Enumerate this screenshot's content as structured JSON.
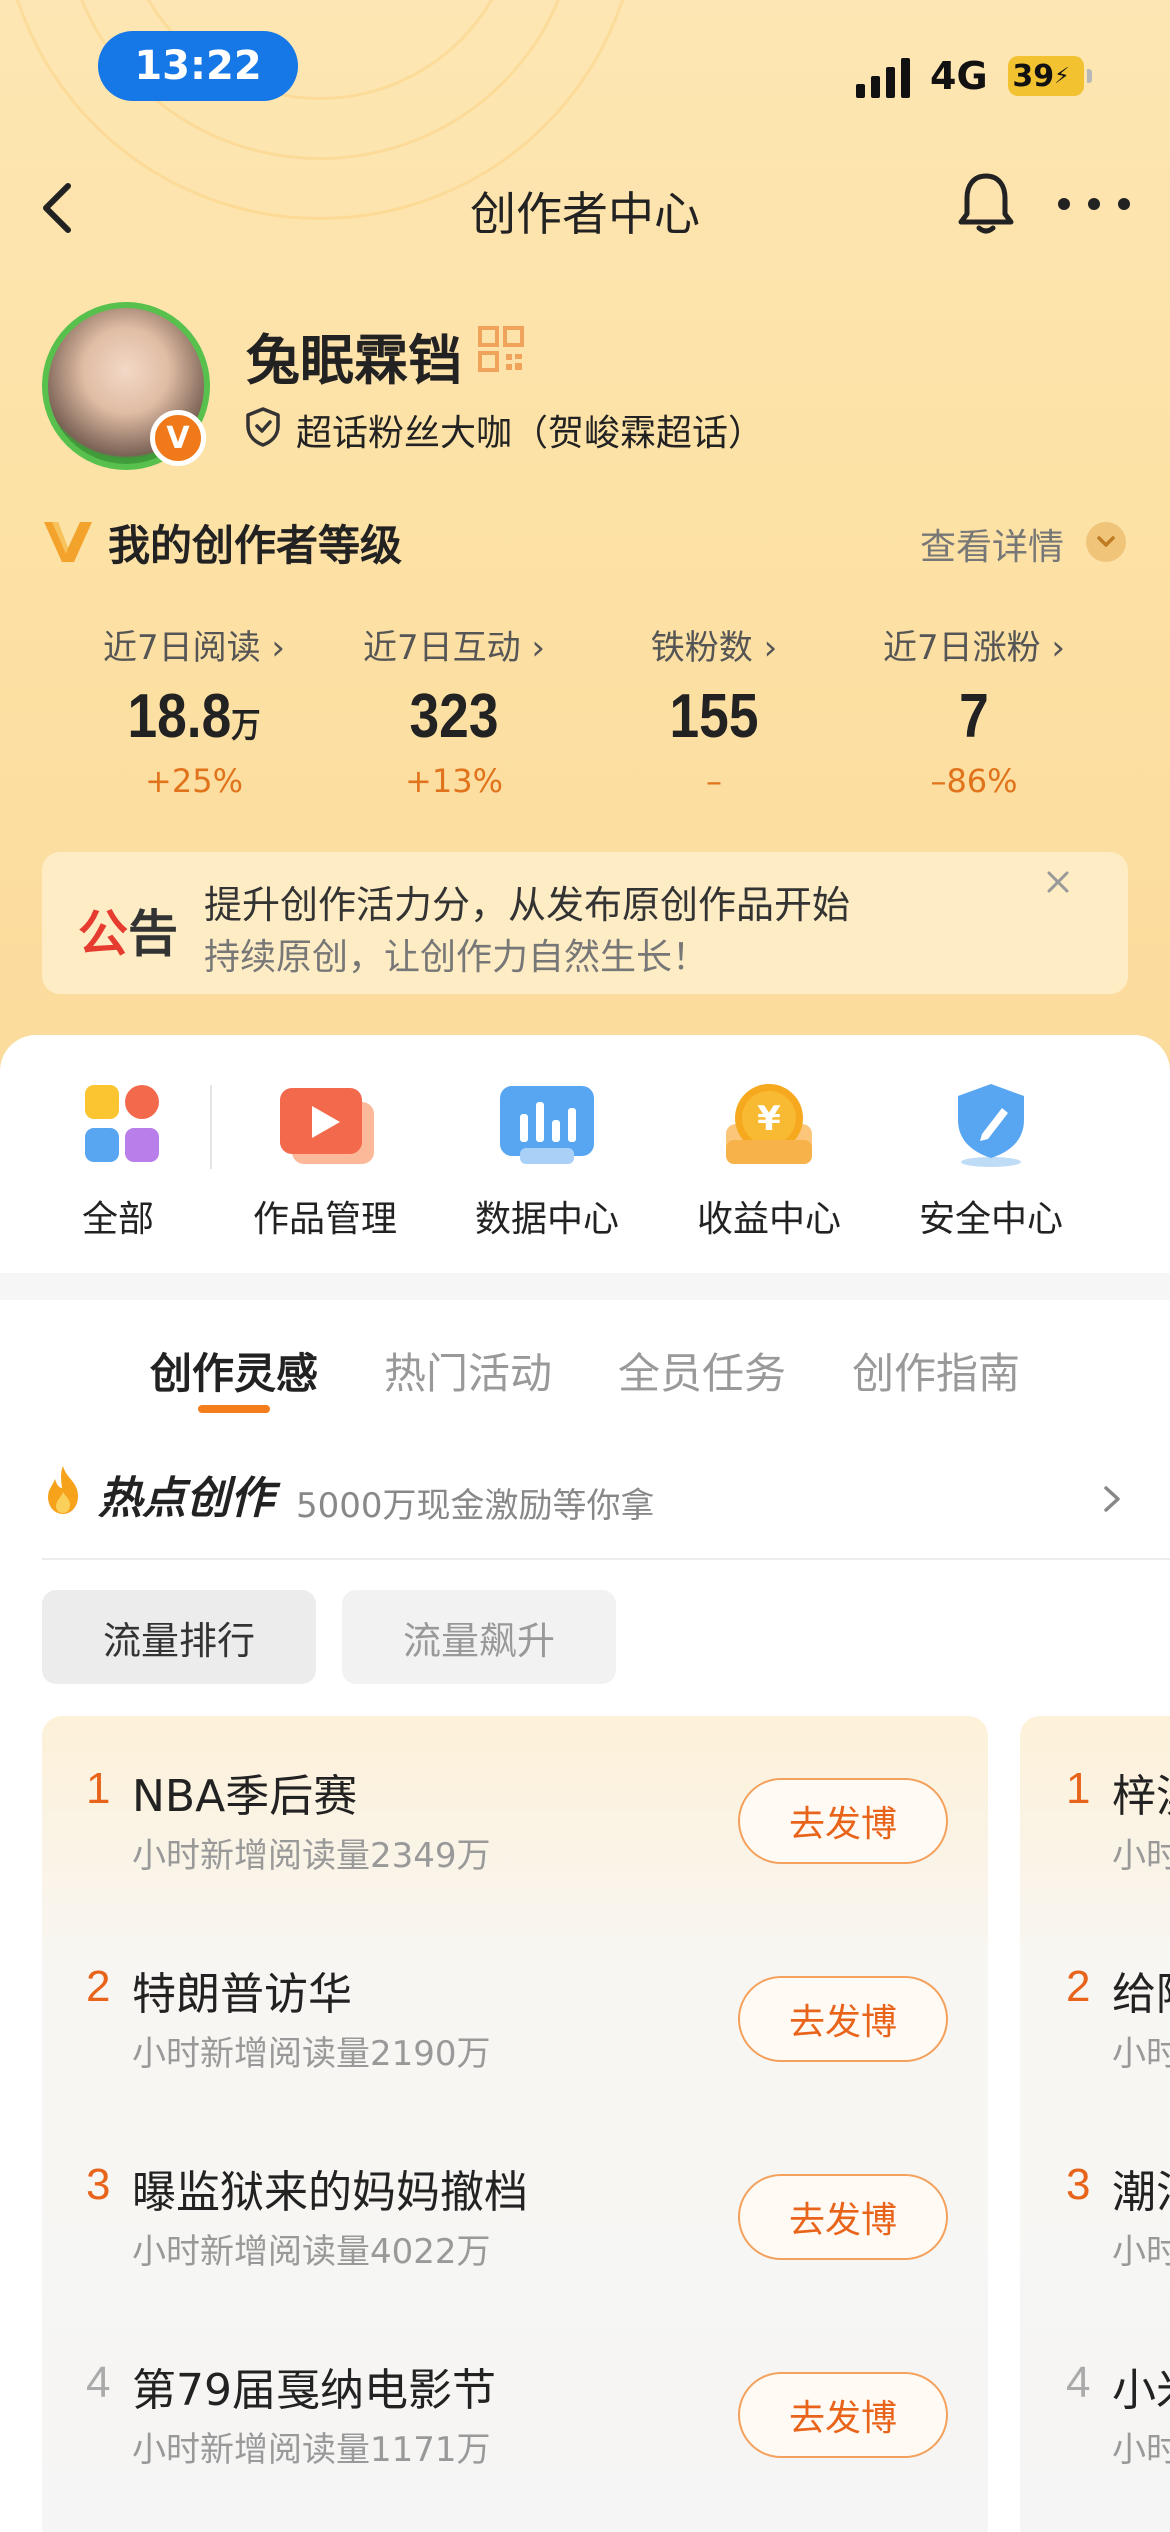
{
  "status_bar": {
    "time": "13:22",
    "network": "4G",
    "battery": "39"
  },
  "nav": {
    "title": "创作者中心"
  },
  "profile": {
    "username": "兔眠霖铛",
    "avatar_badge": "V",
    "fan_title": "超话粉丝大咖（贺峻霖超话）"
  },
  "level": {
    "title": "我的创作者等级",
    "detail_link": "查看详情"
  },
  "stats": [
    {
      "label": "近7日阅读",
      "value": "18.8",
      "unit": "万",
      "change": "+25%"
    },
    {
      "label": "近7日互动",
      "value": "323",
      "unit": "",
      "change": "+13%"
    },
    {
      "label": "铁粉数",
      "value": "155",
      "unit": "",
      "change": "–"
    },
    {
      "label": "近7日涨粉",
      "value": "7",
      "unit": "",
      "change": "–86%"
    }
  ],
  "announcement": {
    "tag_red": "公",
    "tag_dark": "告",
    "line1": "提升创作活力分，从发布原创作品开始",
    "line2": "持续原创，让创作力自然生长！"
  },
  "tools": [
    {
      "label": "全部",
      "icon": "grid-icon"
    },
    {
      "label": "作品管理",
      "icon": "video-icon"
    },
    {
      "label": "数据中心",
      "icon": "chart-icon"
    },
    {
      "label": "收益中心",
      "icon": "yuan-icon"
    },
    {
      "label": "安全中心",
      "icon": "shield-pen-icon"
    }
  ],
  "tabs": [
    {
      "label": "创作灵感",
      "active": true
    },
    {
      "label": "热门活动",
      "active": false
    },
    {
      "label": "全员任务",
      "active": false
    },
    {
      "label": "创作指南",
      "active": false
    }
  ],
  "hot": {
    "title": "热点创作",
    "subtitle": "5000万现金激励等你拿"
  },
  "filters": [
    {
      "label": "流量排行",
      "active": true
    },
    {
      "label": "流量飙升",
      "active": false
    }
  ],
  "post_button_label": "去发博",
  "rankings": [
    {
      "rank": "1",
      "title": "NBA季后赛",
      "sub": "小时新增阅读量2349万"
    },
    {
      "rank": "2",
      "title": "特朗普访华",
      "sub": "小时新增阅读量2190万"
    },
    {
      "rank": "3",
      "title": "曝监狱来的妈妈撤档",
      "sub": "小时新增阅读量4022万"
    },
    {
      "rank": "4",
      "title": "第79届戛纳电影节",
      "sub": "小时新增阅读量1171万"
    }
  ],
  "rankings_right": [
    {
      "rank": "1",
      "title": "梓淇",
      "sub": "小时"
    },
    {
      "rank": "2",
      "title": "给阿",
      "sub": "小时"
    },
    {
      "rank": "3",
      "title": "潮汕",
      "sub": "小时"
    },
    {
      "rank": "4",
      "title": "小米",
      "sub": "小时"
    }
  ],
  "colors": {
    "accent": "#e8641b",
    "status_pill": "#1677e6",
    "header_bg": "#fde2a6"
  }
}
